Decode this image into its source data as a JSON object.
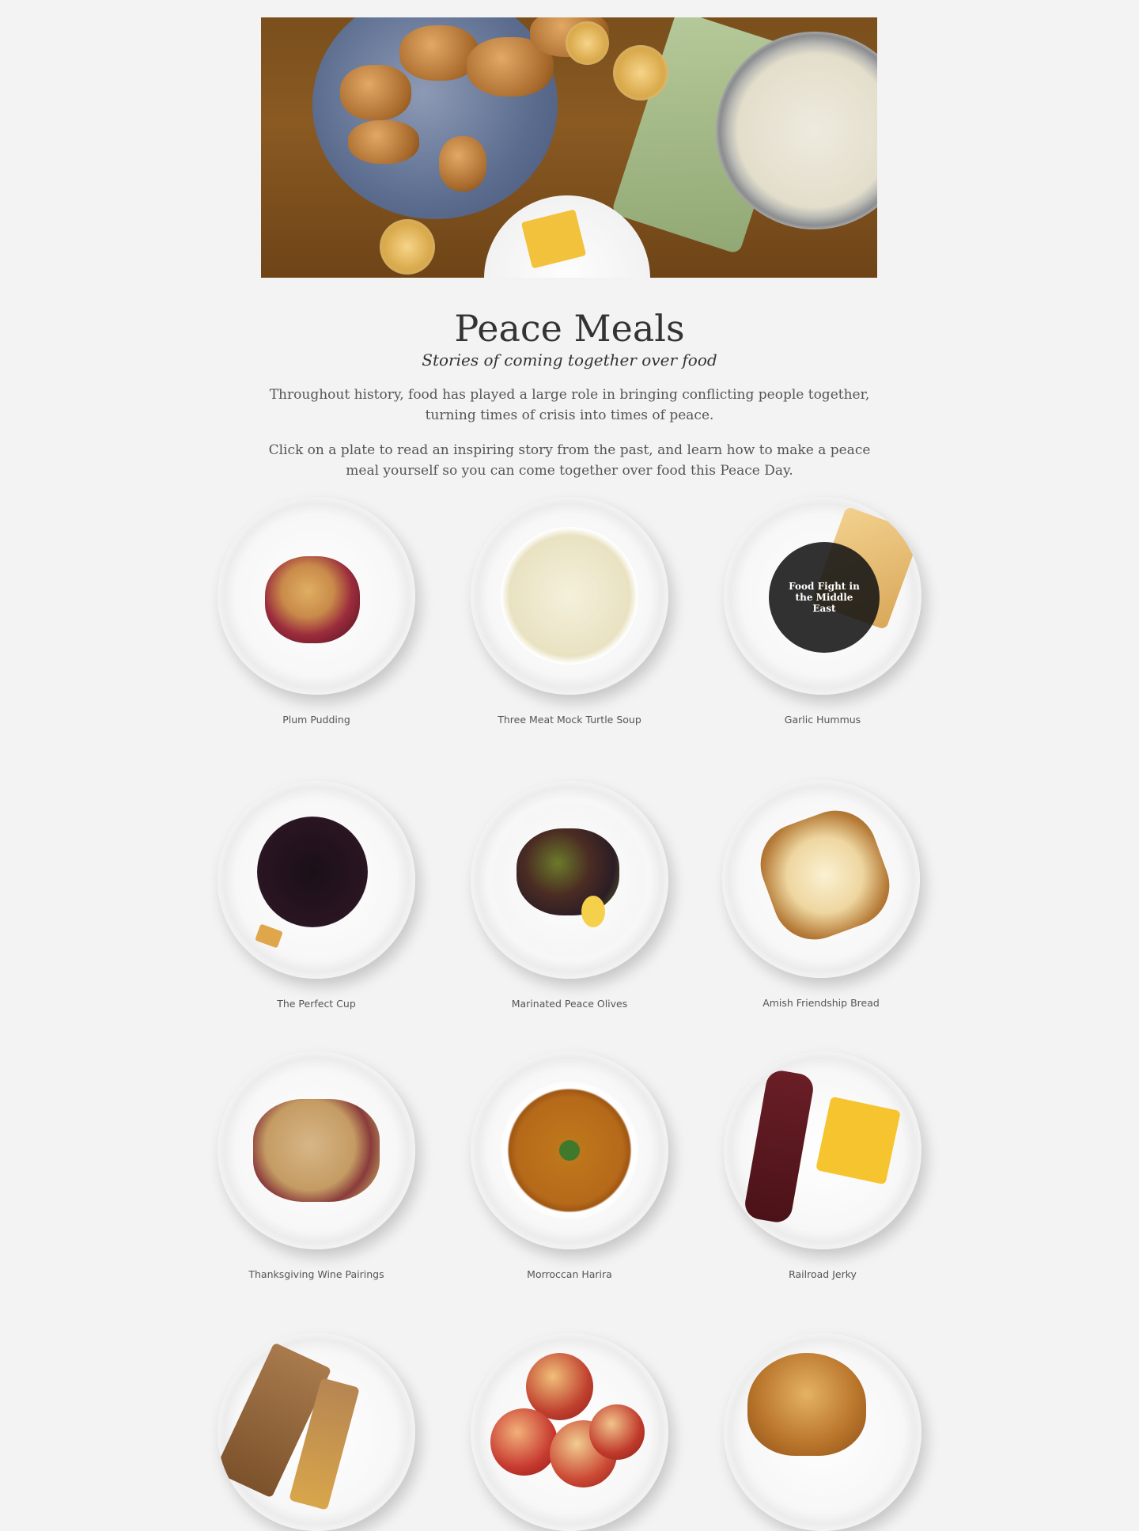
{
  "page": {
    "title": "Peace Meals",
    "subtitle": "Stories of coming together over food",
    "intro_1": "Throughout history, food has played a large role in bringing conflicting people together, turning times of crisis into times of peace.",
    "intro_2": "Click on a plate to read an inspiring story from the past, and learn how to make a peace meal yourself so you can come together over food this Peace Day."
  },
  "plates": [
    {
      "label": "Plum Pudding",
      "icon": "plum-pudding-image"
    },
    {
      "label": "Three Meat Mock Turtle Soup",
      "icon": "turtle-soup-image"
    },
    {
      "label": "Garlic Hummus",
      "icon": "hummus-image",
      "hover_text": "Food Fight in the Middle East"
    },
    {
      "label": "The Perfect Cup",
      "icon": "coffee-cup-image"
    },
    {
      "label": "Marinated Peace Olives",
      "icon": "olives-image"
    },
    {
      "label": "Amish Friendship Bread",
      "icon": "friendship-bread-image"
    },
    {
      "label": "Thanksgiving Wine Pairings",
      "icon": "wine-corks-image"
    },
    {
      "label": "Morroccan Harira",
      "icon": "harira-soup-image"
    },
    {
      "label": "Railroad Jerky",
      "icon": "jerky-cornbread-image"
    },
    {
      "label": "",
      "icon": "bar-cake-image"
    },
    {
      "label": "",
      "icon": "apples-image"
    },
    {
      "label": "",
      "icon": "croissant-image"
    }
  ],
  "colors": {
    "background": "#f3f3f3",
    "text": "#333333",
    "overlay": "#141414"
  }
}
